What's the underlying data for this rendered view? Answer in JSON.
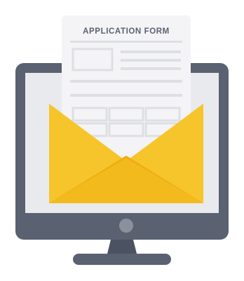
{
  "form": {
    "title": "APPLICATION FORM"
  },
  "colors": {
    "monitor_frame": "#5A6170",
    "monitor_stand": "#4B5261",
    "screen": "#E9EAED",
    "paper": "#F4F4F6",
    "paper_lines": "#DEDFE3",
    "envelope_back": "#F1B91E",
    "envelope_front": "#F6C52B",
    "envelope_flap_shadow": "#EFAE12",
    "title_text": "#5A6170",
    "power_button": "#8A909C"
  },
  "icons": {
    "illustration": "monitor-envelope-form-icon"
  }
}
